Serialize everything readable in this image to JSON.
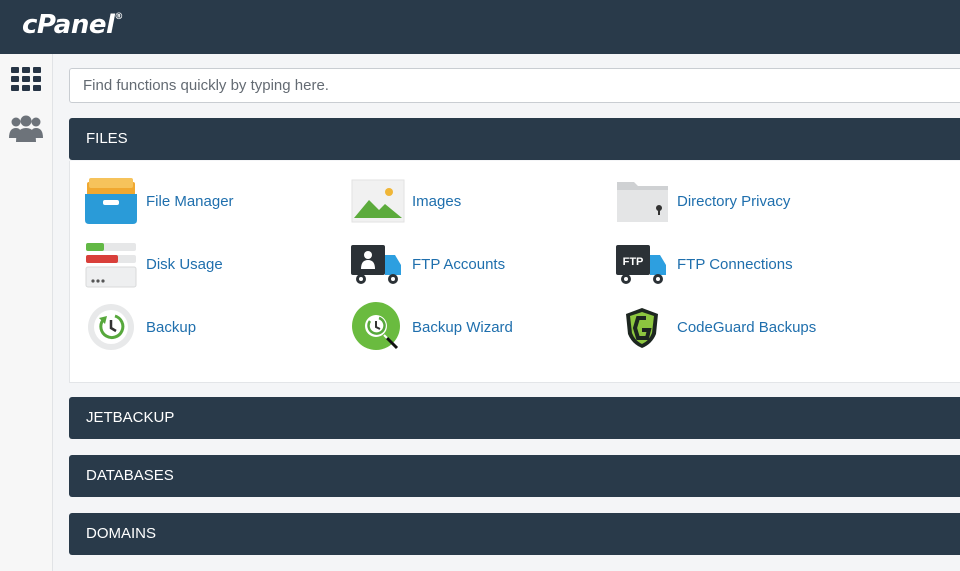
{
  "header": {
    "logo": "cPanel",
    "logo_mark": "®"
  },
  "sidebar": {
    "items": [
      {
        "icon": "grid-icon"
      },
      {
        "icon": "users-icon"
      }
    ]
  },
  "search": {
    "placeholder": "Find functions quickly by typing here."
  },
  "sections": [
    {
      "title": "FILES",
      "items": [
        {
          "label": "File Manager",
          "icon": "file-manager-icon"
        },
        {
          "label": "Images",
          "icon": "images-icon"
        },
        {
          "label": "Directory Privacy",
          "icon": "directory-privacy-icon"
        },
        {
          "label": "Disk Usage",
          "icon": "disk-usage-icon"
        },
        {
          "label": "FTP Accounts",
          "icon": "ftp-accounts-icon"
        },
        {
          "label": "FTP Connections",
          "icon": "ftp-connections-icon",
          "badge": "FTP"
        },
        {
          "label": "Backup",
          "icon": "backup-icon"
        },
        {
          "label": "Backup Wizard",
          "icon": "backup-wizard-icon"
        },
        {
          "label": "CodeGuard Backups",
          "icon": "codeguard-icon"
        }
      ]
    },
    {
      "title": "JETBACKUP"
    },
    {
      "title": "DATABASES"
    },
    {
      "title": "DOMAINS"
    }
  ],
  "colors": {
    "header": "#293a4a",
    "link": "#1f6fad",
    "background": "#f4f5f7"
  }
}
